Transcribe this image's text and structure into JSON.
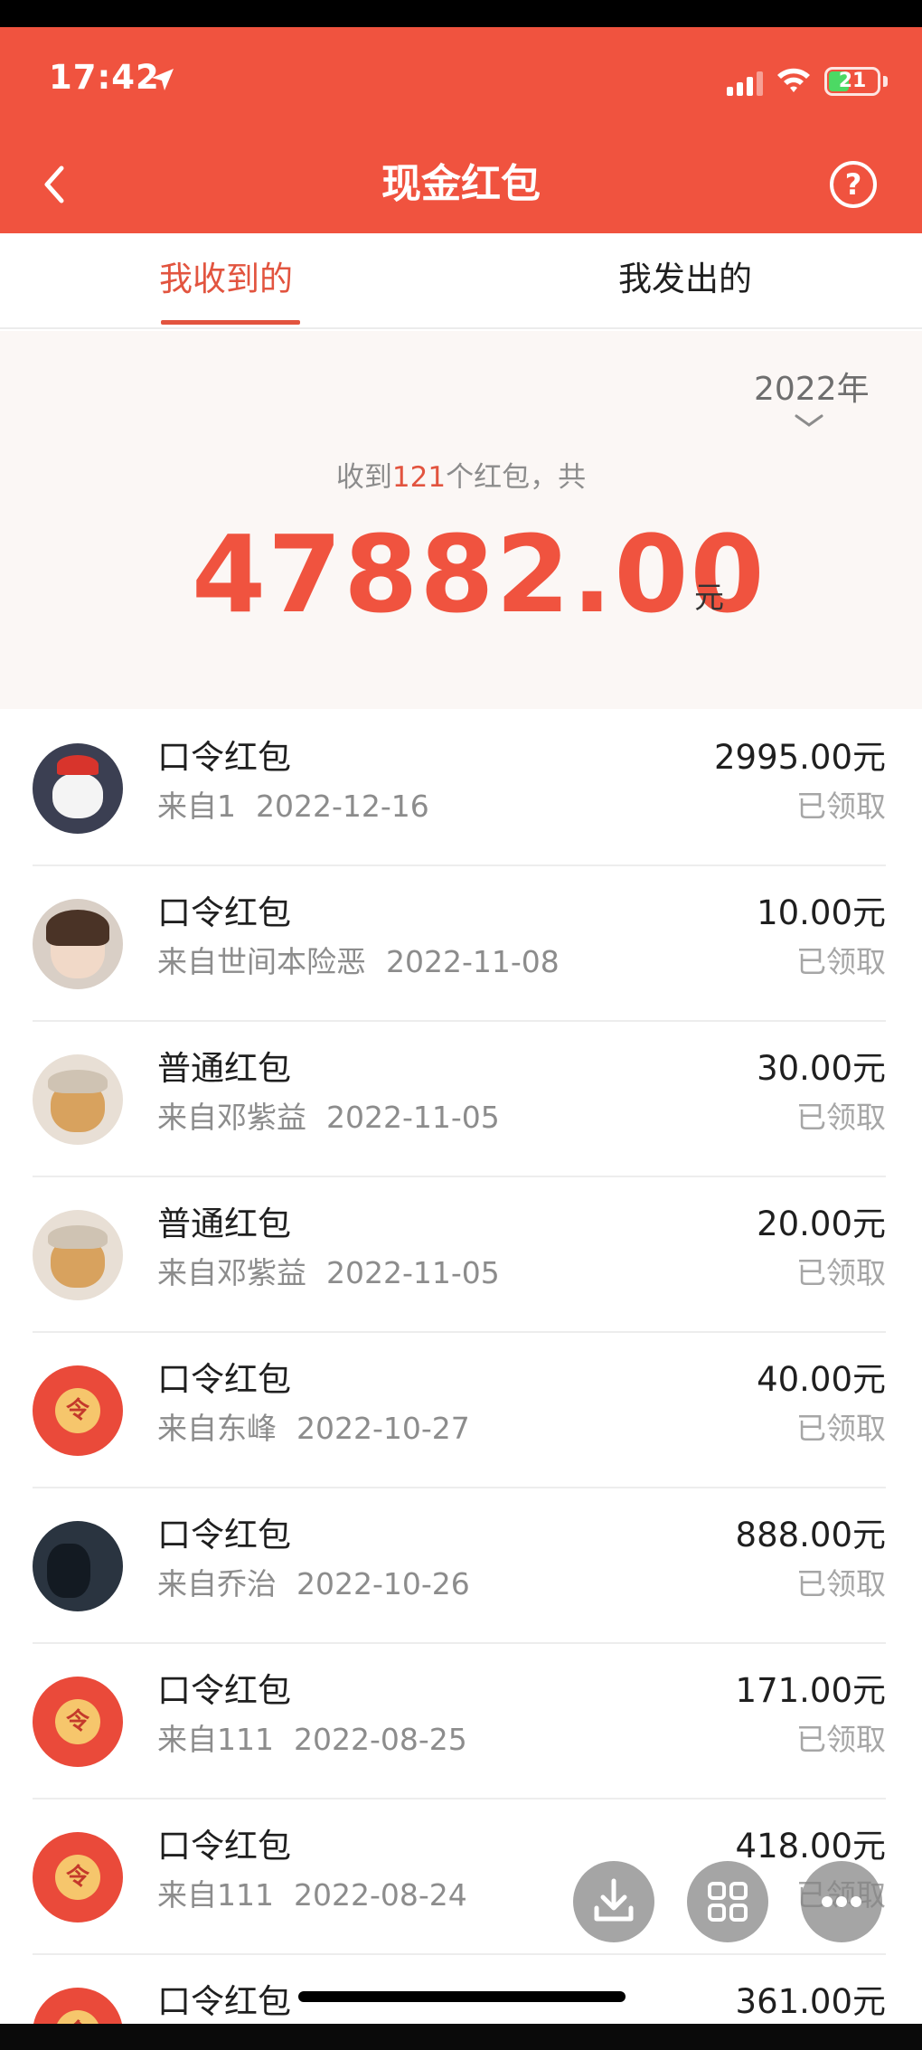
{
  "status_bar": {
    "time": "17:42",
    "battery": "21"
  },
  "nav": {
    "title": "现金红包"
  },
  "tabs": [
    {
      "label": "我收到的",
      "active": true
    },
    {
      "label": "我发出的",
      "active": false
    }
  ],
  "summary": {
    "year": "2022年",
    "prefix": "收到",
    "count": "121",
    "suffix": "个红包，共",
    "total": "47882.00",
    "unit": "元"
  },
  "list": [
    {
      "type": "口令红包",
      "sender": "来自1",
      "date": "2022-12-16",
      "amount": "2995.00元",
      "status": "已领取",
      "avatar": "santa"
    },
    {
      "type": "口令红包",
      "sender": "来自世间本险恶",
      "date": "2022-11-08",
      "amount": "10.00元",
      "status": "已领取",
      "avatar": "kid"
    },
    {
      "type": "普通红包",
      "sender": "来自邓紫益",
      "date": "2022-11-05",
      "amount": "30.00元",
      "status": "已领取",
      "avatar": "dog"
    },
    {
      "type": "普通红包",
      "sender": "来自邓紫益",
      "date": "2022-11-05",
      "amount": "20.00元",
      "status": "已领取",
      "avatar": "dog"
    },
    {
      "type": "口令红包",
      "sender": "来自东峰",
      "date": "2022-10-27",
      "amount": "40.00元",
      "status": "已领取",
      "avatar": "ling"
    },
    {
      "type": "口令红包",
      "sender": "来自乔治",
      "date": "2022-10-26",
      "amount": "888.00元",
      "status": "已领取",
      "avatar": "dark"
    },
    {
      "type": "口令红包",
      "sender": "来自111",
      "date": "2022-08-25",
      "amount": "171.00元",
      "status": "已领取",
      "avatar": "ling"
    },
    {
      "type": "口令红包",
      "sender": "来自111",
      "date": "2022-08-24",
      "amount": "418.00元",
      "status": "已领取",
      "avatar": "ling"
    },
    {
      "type": "口令红包",
      "sender": "",
      "date": "",
      "amount": "361.00元",
      "status": "",
      "avatar": "ling"
    }
  ],
  "avatar_glyph": "令",
  "colors": {
    "header": "#f0533f",
    "accent": "#e2543f",
    "summary_bg": "#fbf7f5"
  },
  "icons": [
    "location-arrow-icon",
    "signal-icon",
    "wifi-icon",
    "battery-icon",
    "back-icon",
    "help-icon",
    "chevron-down-icon",
    "download-icon",
    "grid-icon",
    "more-icon"
  ]
}
